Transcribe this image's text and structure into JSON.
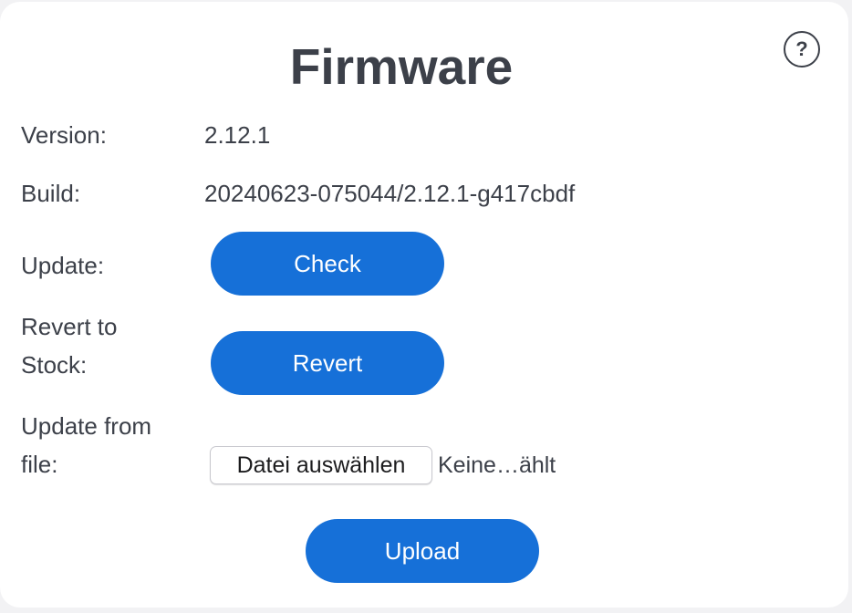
{
  "colors": {
    "accent": "#1670d8",
    "text": "#3c4049",
    "card_background": "#ffffff",
    "page_background": "#f2f2f4"
  },
  "header": {
    "title": "Firmware",
    "help_icon": "question-circle-icon",
    "help_symbol": "?"
  },
  "info": {
    "version_label": "Version:",
    "version_value": "2.12.1",
    "build_label": "Build:",
    "build_value": "20240623-075044/2.12.1-g417cbdf"
  },
  "update": {
    "label": "Update:",
    "button": "Check"
  },
  "revert": {
    "label_line1": "Revert to",
    "label_line2": "Stock:",
    "button": "Revert"
  },
  "file_update": {
    "label_line1": "Update from",
    "label_line2": "file:",
    "choose_button": "Datei auswählen",
    "status": "Keine…ählt"
  },
  "upload": {
    "button": "Upload"
  }
}
